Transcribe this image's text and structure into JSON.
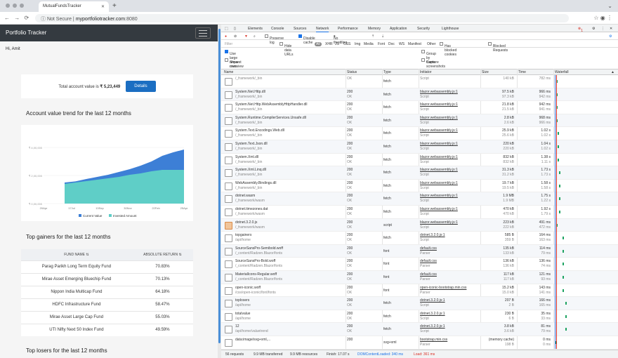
{
  "browser": {
    "tab_title": "MutualFundsTracker",
    "not_secure": "Not Secure",
    "url_host": "myportfoliotracker.com",
    "url_port": ":8080"
  },
  "app": {
    "brand": "Portfolio Tracker",
    "greeting": "Hi, Amit",
    "total_label": "Total account value is",
    "total_value": "₹ 5,23,449",
    "details_button": "Details",
    "trend_heading": "Account value trend for the last 12 months",
    "gainers_heading": "Top gainers for the last 12 months",
    "losers_heading": "Top losers for the last 12 months",
    "table_headers": [
      "FUND NAME",
      "ABSOLUTE RETURN"
    ],
    "gainers": [
      {
        "name": "Parag Parikh Long Term Equity Fund",
        "ret": "70.83%"
      },
      {
        "name": "Mirae Asset Emerging Bluechip Fund",
        "ret": "70.13%"
      },
      {
        "name": "Nippon India Multicap Fund",
        "ret": "64.18%"
      },
      {
        "name": "HDFC Infrastructure Fund",
        "ret": "58.47%"
      },
      {
        "name": "Mirae Asset Large Cap Fund",
        "ret": "55.03%"
      },
      {
        "name": "UTI Nifty Next 50 Index Fund",
        "ret": "49.59%"
      }
    ]
  },
  "chart_data": {
    "type": "area",
    "x": [
      "20Apr",
      "17Jul",
      "13Sep",
      "30Nov",
      "22Feb",
      "25Apr"
    ],
    "y_ticks": [
      "₹ 0,00,000",
      "₹ 2,00,000",
      "₹ 4,00,000"
    ],
    "series": [
      {
        "name": "Current Value",
        "color": "#3d7fd6",
        "values": [
          150000,
          158000,
          175000,
          190000,
          205000,
          225000,
          245000,
          270000,
          300000,
          340000,
          365000,
          385000
        ]
      },
      {
        "name": "Invested Amount",
        "color": "#5fcec7",
        "values": [
          140000,
          150000,
          160000,
          170000,
          180000,
          190000,
          205000,
          215000,
          230000,
          240000,
          240000,
          240000
        ]
      }
    ],
    "ylim": [
      0,
      500000
    ]
  },
  "devtools": {
    "tabs": [
      "Elements",
      "Console",
      "Sources",
      "Network",
      "Performance",
      "Memory",
      "Application",
      "Security",
      "Lighthouse"
    ],
    "error_count": "1",
    "toolbar": {
      "preserve_log": "Preserve log",
      "disable_cache": "Disable cache",
      "throttling": "No throttling"
    },
    "filter": {
      "placeholder": "Filter",
      "hide_data_urls": "Hide data URLs",
      "types": [
        "All",
        "XHR",
        "JS",
        "CSS",
        "Img",
        "Media",
        "Font",
        "Doc",
        "WS",
        "Manifest",
        "Other"
      ],
      "has_blocked_cookies": "Has blocked cookies",
      "blocked_requests": "Blocked Requests"
    },
    "options": {
      "large_rows": "Use large request rows",
      "group_by_frame": "Group by frame",
      "show_overview": "Show overview",
      "capture_screenshots": "Capture screenshots"
    },
    "columns": [
      "Name",
      "Status",
      "Type",
      "Initiator",
      "Size",
      "Time",
      "Waterfall"
    ],
    "requests": [
      {
        "name": "",
        "path": "/_framework/_bin",
        "status": "",
        "statusText": "OK",
        "type": "fetch",
        "init": "",
        "init2": "Script",
        "size": "",
        "size2": "140 kB",
        "time": "",
        "time2": "782 ms",
        "wf": 0
      },
      {
        "name": "System.Net.Http.dll",
        "path": "/_framework/_bin",
        "status": "200",
        "statusText": "OK",
        "type": "fetch",
        "init": "blazor.webassembly.js:1",
        "init2": "Script",
        "size": "97.5 kB",
        "size2": "97.3 kB",
        "time": "966 ms",
        "time2": "942 ms",
        "wf": 0
      },
      {
        "name": "System.Net.Http.WebAssemblyHttpHandler.dll",
        "path": "/_framework/_bin",
        "status": "200",
        "statusText": "OK",
        "type": "fetch",
        "init": "blazor.webassembly.js:1",
        "init2": "Script",
        "size": "21.8 kB",
        "size2": "21.5 kB",
        "time": "942 ms",
        "time2": "941 ms",
        "wf": 0
      },
      {
        "name": "System.Runtime.CompilerServices.Unsafe.dll",
        "path": "/_framework/_bin",
        "status": "200",
        "statusText": "OK",
        "type": "fetch",
        "init": "blazor.webassembly.js:1",
        "init2": "Script",
        "size": "2.8 kB",
        "size2": "2.6 kB",
        "time": "968 ms",
        "time2": "966 ms",
        "wf": 0
      },
      {
        "name": "System.Text.Encodings.Web.dll",
        "path": "/_framework/_bin",
        "status": "200",
        "statusText": "OK",
        "type": "fetch",
        "init": "blazor.webassembly.js:1",
        "init2": "Script",
        "size": "25.9 kB",
        "size2": "25.6 kB",
        "time": "1.02 s",
        "time2": "1.02 s",
        "wf": 1
      },
      {
        "name": "System.Text.Json.dll",
        "path": "/_framework/_bin",
        "status": "200",
        "statusText": "OK",
        "type": "fetch",
        "init": "blazor.webassembly.js:1",
        "init2": "Script",
        "size": "220 kB",
        "size2": "220 kB",
        "time": "1.04 s",
        "time2": "1.02 s",
        "wf": 1
      },
      {
        "name": "System.Xml.dll",
        "path": "/_framework/_bin",
        "status": "200",
        "statusText": "OK",
        "type": "fetch",
        "init": "blazor.webassembly.js:1",
        "init2": "Script",
        "size": "832 kB",
        "size2": "832 kB",
        "time": "1.38 s",
        "time2": "1.11 s",
        "wf": 1
      },
      {
        "name": "System.Xml.Linq.dll",
        "path": "/_framework/_bin",
        "status": "200",
        "statusText": "OK",
        "type": "fetch",
        "init": "blazor.webassembly.js:1",
        "init2": "Script",
        "size": "31.3 kB",
        "size2": "31.2 kB",
        "time": "1.73 s",
        "time2": "1.73 s",
        "wf": 2
      },
      {
        "name": "WebAssembly.Bindings.dll",
        "path": "/_framework/_bin",
        "status": "200",
        "statusText": "OK",
        "type": "fetch",
        "init": "blazor.webassembly.js:1",
        "init2": "Script",
        "size": "19.7 kB",
        "size2": "19.5 kB",
        "time": "1.58 s",
        "time2": "1.58 s",
        "wf": 2
      },
      {
        "name": "dotnet.wasm",
        "path": "/_framework/wasm",
        "status": "200",
        "statusText": "OK",
        "type": "fetch",
        "init": "blazor.webassembly.js:1",
        "init2": "Script",
        "size": "1.9 MB",
        "size2": "1.9 MB",
        "time": "1.75 s",
        "time2": "1.22 s",
        "wf": 2
      },
      {
        "name": "dotnet.timezones.dat",
        "path": "/_framework/wasm",
        "status": "200",
        "statusText": "OK",
        "type": "fetch",
        "init": "blazor.webassembly.js:1",
        "init2": "Script",
        "size": "470 kB",
        "size2": "470 kB",
        "time": "1.92 s",
        "time2": "1.79 s",
        "wf": 2
      },
      {
        "name": "dotnet.3.2.0.js",
        "path": "/_framework/wasm",
        "status": "200",
        "statusText": "OK",
        "type": "script",
        "init": "blazor.webassembly.js:1",
        "init2": "Script",
        "size": "223 kB",
        "size2": "222 kB",
        "time": "491 ms",
        "time2": "472 ms",
        "wf": 0,
        "js": true
      },
      {
        "name": "topgainers",
        "path": "/api/home",
        "status": "200",
        "statusText": "OK",
        "type": "fetch",
        "init": "dotnet.3.2.0.js:1",
        "init2": "Script",
        "size": "585 B",
        "size2": "359 B",
        "time": "164 ms",
        "time2": "163 ms",
        "wf": 3
      },
      {
        "name": "SourceSansPro-Semibold.woff",
        "path": "/_content/Radzen.Blazor/fonts",
        "status": "200",
        "statusText": "OK",
        "type": "font",
        "init": "default.css",
        "init2": "Parser",
        "size": "135 kB",
        "size2": "133 kB",
        "time": "114 ms",
        "time2": "79 ms",
        "wf": 3
      },
      {
        "name": "SourceSansPro-Bold.woff",
        "path": "/_content/Radzen.Blazor/fonts",
        "status": "200",
        "statusText": "OK",
        "type": "font",
        "init": "default.css",
        "init2": "Parser",
        "size": "136 kB",
        "size2": "136 kB",
        "time": "136 ms",
        "time2": "74 ms",
        "wf": 3
      },
      {
        "name": "MaterialIcons-Regular.woff",
        "path": "/_content/Radzen.Blazor/fonts",
        "status": "200",
        "statusText": "OK",
        "type": "font",
        "init": "default.css",
        "init2": "Parser",
        "size": "117 kB",
        "size2": "117 kB",
        "time": "121 ms",
        "time2": "93 ms",
        "wf": 3
      },
      {
        "name": "open-iconic.woff",
        "path": "/css/open-iconic/font/fonts",
        "status": "200",
        "statusText": "OK",
        "type": "font",
        "init": "open-iconic-bootstrap.min.css",
        "init2": "Parser",
        "size": "15.2 kB",
        "size2": "15.0 kB",
        "time": "143 ms",
        "time2": "141 ms",
        "wf": 3
      },
      {
        "name": "toplosers",
        "path": "/api/home",
        "status": "200",
        "statusText": "OK",
        "type": "fetch",
        "init": "dotnet.3.2.0.js:1",
        "init2": "Script",
        "size": "207 B",
        "size2": "2 B",
        "time": "166 ms",
        "time2": "165 ms",
        "wf": 4
      },
      {
        "name": "totalvalue",
        "path": "/api/home",
        "status": "200",
        "statusText": "OK",
        "type": "fetch",
        "init": "dotnet.3.2.0.js:1",
        "init2": "Script",
        "size": "230 B",
        "size2": "6 B",
        "time": "35 ms",
        "time2": "33 ms",
        "wf": 4
      },
      {
        "name": "12",
        "path": "/api/home/valuetrend",
        "status": "200",
        "statusText": "OK",
        "type": "fetch",
        "init": "dotnet.3.2.0.js:1",
        "init2": "Script",
        "size": "3.8 kB",
        "size2": "3.6 kB",
        "time": "81 ms",
        "time2": "79 ms",
        "wf": 4
      },
      {
        "name": "data:image/svg+xml,...",
        "path": "",
        "status": "200",
        "statusText": "",
        "type": "svg+xml",
        "init": "bootstrap.min.css",
        "init2": "Parser",
        "size": "(memory cache)",
        "size2": "198 B",
        "time": "0 ms",
        "time2": "0 ms",
        "wf": 5
      }
    ],
    "status_bar": {
      "requests": "56 requests",
      "transferred": "9.9 MB transferred",
      "resources": "9.9 MB resources",
      "finish": "Finish: 17.07 s",
      "dcl": "DOMContentLoaded: 340 ms",
      "load": "Load: 361 ms"
    }
  }
}
